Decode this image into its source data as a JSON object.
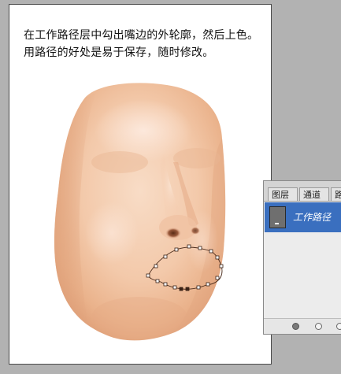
{
  "canvas": {
    "caption_line1": "在工作路径层中勾出嘴边的外轮廓，然后上色。",
    "caption_line2": "用路径的好处是易于保存，随时修改。"
  },
  "paths_panel": {
    "tabs": [
      {
        "label": "图层"
      },
      {
        "label": "通道"
      },
      {
        "label": "路"
      }
    ],
    "items": [
      {
        "name": "工作路径",
        "selected": true,
        "icon": "path-thumbnail"
      }
    ],
    "footer_buttons": [
      {
        "icon": "fill-path-icon"
      },
      {
        "icon": "stroke-path-icon"
      },
      {
        "icon": "load-selection-icon"
      }
    ]
  },
  "colors": {
    "workspace_bg": "#b2b2b2",
    "panel_selected": "#3a6fbf",
    "skin_light": "#f6d6bd",
    "skin_mid": "#eebc98"
  }
}
